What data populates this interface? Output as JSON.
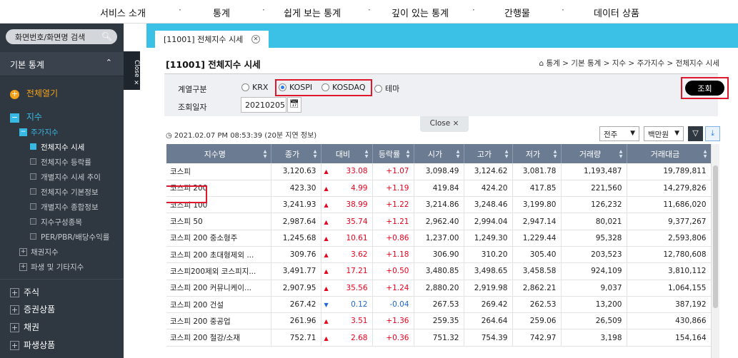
{
  "topnav": {
    "items": [
      "서비스 소개",
      "통계",
      "쉽게 보는 통계",
      "깊이 있는 통계",
      "간행물",
      "데이터 상품"
    ],
    "sep": "·"
  },
  "sidebar": {
    "search_placeholder": "화면번호/화면명 검색",
    "section_title": "기본 통계",
    "expand_all": "전체열기",
    "index": "지수",
    "stock_index": "주가지수",
    "items": [
      "전체지수 시세",
      "전체지수 등락률",
      "개별지수 시세 추이",
      "전체지수 기본정보",
      "개별지수 종합정보",
      "지수구성종목",
      "PER/PBR/배당수익률"
    ],
    "bond_index": "채권지수",
    "deriv_index": "파생 및 기타지수",
    "groups": [
      "주식",
      "증권상품",
      "채권",
      "파생상품"
    ],
    "close_label": "Close ×"
  },
  "tab": {
    "label": "[11001] 전체지수 시세"
  },
  "page": {
    "title": "[11001] 전체지수 시세"
  },
  "breadcrumb": [
    "통계",
    "기본 통계",
    "지수",
    "주가지수",
    "전체지수 시세"
  ],
  "filter": {
    "series_label": "계열구분",
    "options": [
      "KRX",
      "KOSPI",
      "KOSDAQ",
      "테마"
    ],
    "selected": "KOSPI",
    "date_label": "조회일자",
    "date_value": "20210205",
    "search_button": "조회"
  },
  "close_tab": "Close ×",
  "timestamp": "2021.02.07 PM 08:53:39",
  "delay_note": "(20분 지연 정보)",
  "controls": {
    "period": "전주",
    "unit": "백만원"
  },
  "colors": {
    "up": "#e8001c",
    "down": "#2067d8",
    "header": "#6b7c92",
    "accent": "#3bc0e6",
    "highlight": "#e0182d"
  },
  "table": {
    "columns": [
      "지수명",
      "종가",
      "대비",
      "등락률",
      "시가",
      "고가",
      "저가",
      "거래량",
      "거래대금"
    ],
    "rows": [
      {
        "name": "코스피",
        "close": "3,120.63",
        "dir": "up",
        "chg": "33.08",
        "rate": "+1.07",
        "open": "3,098.49",
        "high": "3,124.62",
        "low": "3,081.78",
        "vol": "1,193,487",
        "amt": "19,789,811"
      },
      {
        "name": "코스피 200",
        "close": "423.30",
        "dir": "up",
        "chg": "4.99",
        "rate": "+1.19",
        "open": "419.84",
        "high": "424.20",
        "low": "417.85",
        "vol": "221,560",
        "amt": "14,279,826"
      },
      {
        "name": "코스피 100",
        "close": "3,241.93",
        "dir": "up",
        "chg": "38.99",
        "rate": "+1.22",
        "open": "3,214.86",
        "high": "3,248.46",
        "low": "3,199.80",
        "vol": "126,232",
        "amt": "11,686,020"
      },
      {
        "name": "코스피 50",
        "close": "2,987.64",
        "dir": "up",
        "chg": "35.74",
        "rate": "+1.21",
        "open": "2,962.40",
        "high": "2,994.04",
        "low": "2,947.14",
        "vol": "80,021",
        "amt": "9,377,267"
      },
      {
        "name": "코스피 200 중소형주",
        "close": "1,245.68",
        "dir": "up",
        "chg": "10.61",
        "rate": "+0.86",
        "open": "1,237.00",
        "high": "1,249.30",
        "low": "1,229.44",
        "vol": "95,328",
        "amt": "2,593,806"
      },
      {
        "name": "코스피 200 초대형제외 ...",
        "close": "309.76",
        "dir": "up",
        "chg": "3.62",
        "rate": "+1.18",
        "open": "306.90",
        "high": "310.20",
        "low": "305.40",
        "vol": "203,523",
        "amt": "12,780,608"
      },
      {
        "name": "코스피200제외 코스피지...",
        "close": "3,491.77",
        "dir": "up",
        "chg": "17.21",
        "rate": "+0.50",
        "open": "3,480.85",
        "high": "3,498.65",
        "low": "3,458.58",
        "vol": "924,109",
        "amt": "3,810,112"
      },
      {
        "name": "코스피 200 커뮤니케이...",
        "close": "2,907.95",
        "dir": "up",
        "chg": "35.56",
        "rate": "+1.24",
        "open": "2,880.20",
        "high": "2,919.98",
        "low": "2,862.21",
        "vol": "9,037",
        "amt": "1,064,155"
      },
      {
        "name": "코스피 200 건설",
        "close": "267.42",
        "dir": "down",
        "chg": "0.12",
        "rate": "-0.04",
        "open": "267.53",
        "high": "269.42",
        "low": "262.53",
        "vol": "13,200",
        "amt": "387,192"
      },
      {
        "name": "코스피 200 중공업",
        "close": "261.96",
        "dir": "up",
        "chg": "3.51",
        "rate": "+1.36",
        "open": "259.35",
        "high": "264.64",
        "low": "259.06",
        "vol": "26,509",
        "amt": "430,866"
      },
      {
        "name": "코스피 200 철강/소재",
        "close": "752.71",
        "dir": "up",
        "chg": "2.68",
        "rate": "+0.36",
        "open": "751.32",
        "high": "754.39",
        "low": "742.97",
        "vol": "3,198",
        "amt": "154,164"
      }
    ]
  }
}
